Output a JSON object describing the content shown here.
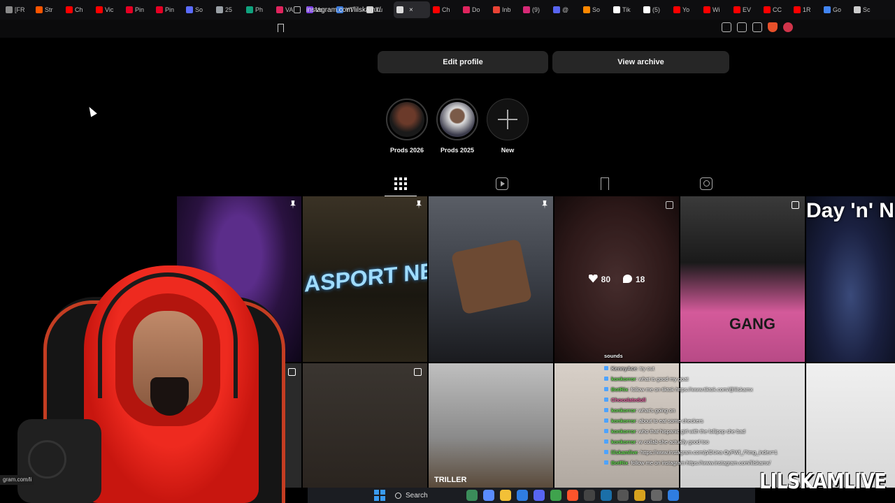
{
  "browser": {
    "tabs": [
      {
        "label": "[FR",
        "icon": "generic-tab-icon",
        "color": "#8a8a8a"
      },
      {
        "label": "Str",
        "icon": "soundcloud-icon",
        "color": "#ff5500"
      },
      {
        "label": "Ch",
        "icon": "youtube-icon",
        "color": "#ff0000"
      },
      {
        "label": "Vic",
        "icon": "youtube-icon",
        "color": "#ff0000"
      },
      {
        "label": "Pin",
        "icon": "pinterest-icon",
        "color": "#e60023"
      },
      {
        "label": "Pin",
        "icon": "pinterest-icon",
        "color": "#e60023"
      },
      {
        "label": "So",
        "icon": "app-icon",
        "color": "#5b6cff"
      },
      {
        "label": "25",
        "icon": "app-icon",
        "color": "#9aa0a6"
      },
      {
        "label": "Ph",
        "icon": "chatgpt-icon",
        "color": "#10a37f"
      },
      {
        "label": "VA",
        "icon": "app-icon",
        "color": "#e0245e"
      },
      {
        "label": "Vo",
        "icon": "app-icon",
        "color": "#7b3fe4"
      },
      {
        "label": "YT",
        "icon": "app-icon",
        "color": "#3d7bd9"
      },
      {
        "label": "Tu",
        "icon": "app-icon",
        "color": "#cccccc"
      },
      {
        "label": "",
        "icon": "audio-icon",
        "color": "#dddddd",
        "active": true
      },
      {
        "label": "Ch",
        "icon": "youtube-icon",
        "color": "#ff0000"
      },
      {
        "label": "Do",
        "icon": "app-icon",
        "color": "#e0245e"
      },
      {
        "label": "Inb",
        "icon": "gmail-icon",
        "color": "#ea4335"
      },
      {
        "label": "(9)",
        "icon": "instagram-icon",
        "color": "#d62976"
      },
      {
        "label": "@",
        "icon": "app-icon",
        "color": "#5865f2"
      },
      {
        "label": "So",
        "icon": "app-icon",
        "color": "#ff8800"
      },
      {
        "label": "Tik",
        "icon": "tiktok-icon",
        "color": "#ffffff"
      },
      {
        "label": "(5)",
        "icon": "tiktok-icon",
        "color": "#ffffff"
      },
      {
        "label": "Yo",
        "icon": "youtube-icon",
        "color": "#ff0000"
      },
      {
        "label": "Wi",
        "icon": "youtube-icon",
        "color": "#ff0000"
      },
      {
        "label": "EV",
        "icon": "youtube-icon",
        "color": "#ff0000"
      },
      {
        "label": "CC",
        "icon": "youtube-icon",
        "color": "#ff0000"
      },
      {
        "label": "1R",
        "icon": "youtube-icon",
        "color": "#ff0000"
      },
      {
        "label": "Go",
        "icon": "app-icon",
        "color": "#4285f4"
      },
      {
        "label": "Sc",
        "icon": "app-icon",
        "color": "#cccccc"
      }
    ],
    "url": "instagram.com/lilskamx/"
  },
  "profile": {
    "edit_profile_label": "Edit profile",
    "view_archive_label": "View archive",
    "highlights": [
      {
        "label": "Prods 2026"
      },
      {
        "label": "Prods 2025"
      },
      {
        "label": "New"
      }
    ],
    "tabs": [
      "posts",
      "reels",
      "saved",
      "tagged"
    ]
  },
  "posts": [
    {
      "pinned": true,
      "text": ""
    },
    {
      "pinned": true,
      "text": "ASPORT NE"
    },
    {
      "pinned": true,
      "text": ""
    },
    {
      "pinned": false,
      "multi": true,
      "likes": "80",
      "comments": "18"
    },
    {
      "pinned": false,
      "multi": true,
      "text": "GANG"
    },
    {
      "pinned": false,
      "text": "Day 'n' N"
    },
    {
      "pinned": false,
      "multi": true,
      "text": ""
    },
    {
      "pinned": false,
      "multi": true,
      "text": ""
    },
    {
      "pinned": false,
      "text": "TRILLER"
    },
    {
      "pinned": false,
      "text": ""
    },
    {
      "pinned": false,
      "text": ""
    },
    {
      "pinned": false,
      "text": ""
    }
  ],
  "overlay": {
    "chat_title": "sounds",
    "chat": [
      {
        "name": "KennyAce",
        "msg": ": try out",
        "color": "#c9c9c9"
      },
      {
        "name": "konkorror",
        "msg": ": what is good my goat",
        "color": "#62d84e"
      },
      {
        "name": "BotRix",
        "msg": ": follow me on tiktok https://www.tiktok.com/@lilskamx",
        "color": "#62d84e"
      },
      {
        "name": "Chocolatedoll",
        "msg": "",
        "color": "#e05a9a"
      },
      {
        "name": "konkorror",
        "msg": ": what's going on",
        "color": "#62d84e"
      },
      {
        "name": "konkorror",
        "msg": ": about to eat some checkers",
        "color": "#62d84e"
      },
      {
        "name": "konkorror",
        "msg": ": who that hispanic girl with the lollipop she bad",
        "color": "#62d84e"
      },
      {
        "name": "konkorror",
        "msg": ": w collab she actually good too",
        "color": "#62d84e"
      },
      {
        "name": "lilskamlive",
        "msg": ": https://www.instagram.com/p/DUea OyFWf_/?img_index=1",
        "color": "#62d84e"
      },
      {
        "name": "BotRix",
        "msg": ": follow me on instagram https://www.instagram.com/lilskamx/",
        "color": "#62d84e"
      }
    ],
    "watermark": "LILSKAMLIVE",
    "status_url": "gram.com/li"
  },
  "taskbar": {
    "search_label": "Search",
    "apps": [
      {
        "icon": "widgets-icon",
        "color": "#3b8d5a"
      },
      {
        "icon": "copilot-icon",
        "color": "#5a8cff"
      },
      {
        "icon": "file-explorer-icon",
        "color": "#f2c037"
      },
      {
        "icon": "store-icon",
        "color": "#2f7de1"
      },
      {
        "icon": "discord-icon",
        "color": "#5865f2"
      },
      {
        "icon": "app-icon",
        "color": "#3fa34d"
      },
      {
        "icon": "brave-icon",
        "color": "#fb542b"
      },
      {
        "icon": "obs-icon",
        "color": "#444444"
      },
      {
        "icon": "steam-icon",
        "color": "#1b6fa8"
      },
      {
        "icon": "app-icon",
        "color": "#555555"
      },
      {
        "icon": "app-icon",
        "color": "#d6a21e"
      },
      {
        "icon": "app-icon",
        "color": "#666666"
      },
      {
        "icon": "app-icon",
        "color": "#2f7de1"
      }
    ]
  }
}
